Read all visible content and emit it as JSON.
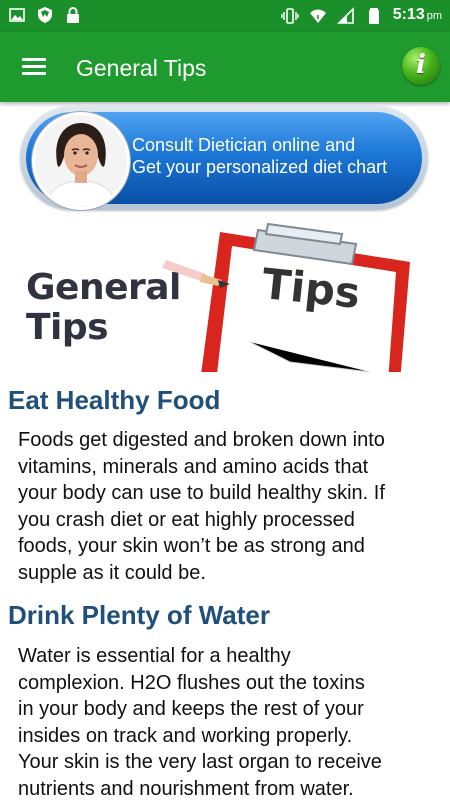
{
  "status_bar": {
    "time": "5:13",
    "ampm": "pm",
    "icons": [
      "gallery-icon",
      "shield-icon",
      "lock-icon",
      "vibrate-icon",
      "wifi-icon",
      "signal-icon",
      "battery-icon"
    ]
  },
  "app_bar": {
    "title": "General Tips",
    "menu_icon": "hamburger-menu-icon",
    "info_icon": "info-icon",
    "info_letter": "i",
    "color": "#1f9a2f"
  },
  "promo": {
    "line1": "Consult Dietician online and",
    "line2": "Get your personalized diet chart"
  },
  "hero": {
    "title_line1": "General",
    "title_line2": "Tips",
    "clipboard_text": "Tips"
  },
  "sections": [
    {
      "heading": "Eat Healthy Food",
      "lines": [
        "Foods get digested and broken down into",
        "vitamins, minerals and amino acids that",
        "your body can use to build healthy skin. If",
        "you crash diet or eat highly processed",
        "foods, your skin won’t be as strong and",
        "supple as it could be."
      ]
    },
    {
      "heading": "Drink Plenty of Water",
      "lines": [
        "Water is essential for a healthy",
        "complexion. H2O flushes out the toxins",
        "in your body and keeps the rest of your",
        "insides on track and working properly.",
        "Your skin is the very last organ to receive",
        "nutrients and nourishment from water."
      ]
    }
  ]
}
